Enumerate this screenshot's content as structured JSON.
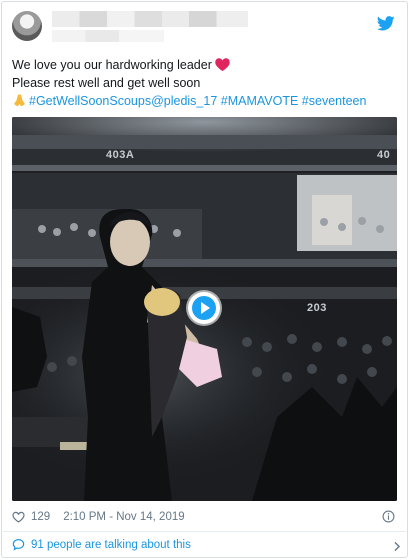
{
  "tweet": {
    "line1": "We love you our hardworking leader",
    "line2": "Please rest well and get well soon",
    "hashtags": [
      "#GetWellSoonScoups",
      "@pledis_17",
      " #MAMAVOTE",
      " #seventeen"
    ]
  },
  "video": {
    "signs": [
      "403A",
      "40",
      "203"
    ]
  },
  "meta": {
    "likes": "129",
    "timestamp": "2:10 PM - Nov 14, 2019"
  },
  "footer": {
    "talking": "91 people are talking about this"
  },
  "colors": {
    "link": "#1b95e0",
    "twitter_blue": "#1da1f2",
    "heart_red": "#e0245e",
    "meta_gray": "#657786"
  },
  "icons": [
    "twitter-bird-icon",
    "red-heart-emoji",
    "folded-hands-emoji",
    "play-icon",
    "like-heart-icon",
    "info-icon",
    "speech-bubble-icon",
    "chevron-right-icon"
  ]
}
